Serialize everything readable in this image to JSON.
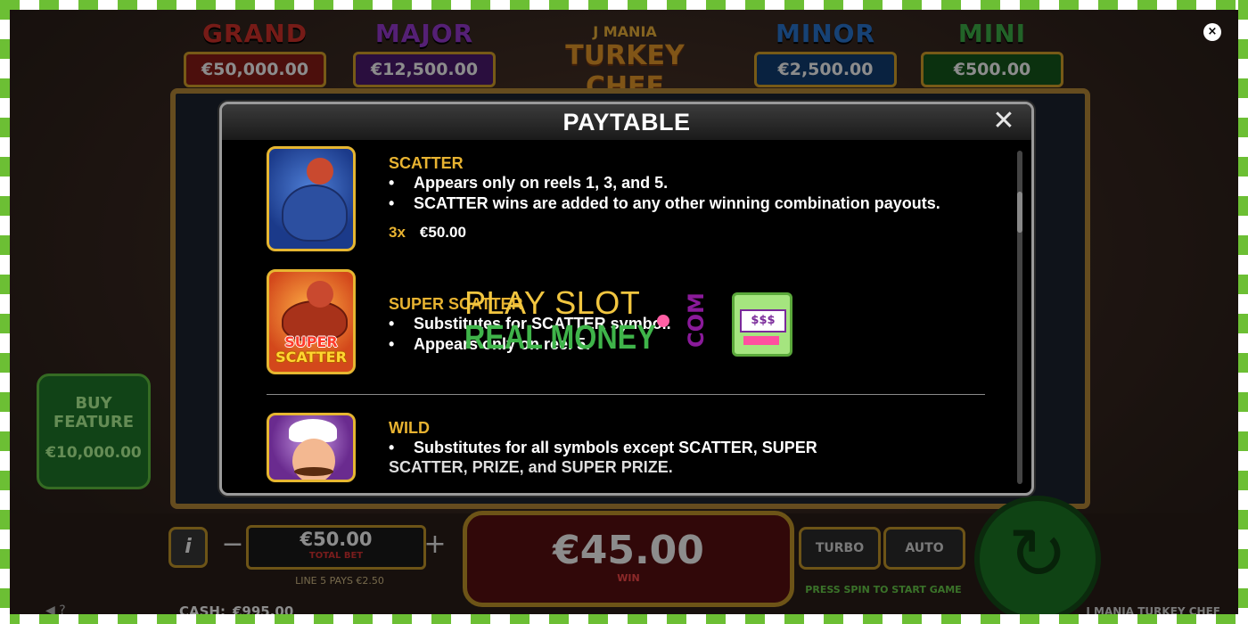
{
  "game": {
    "name": "J MANIA TURKEY CHEF",
    "logo_line1": "J MANIA",
    "logo_line2": "TURKEY CHEF"
  },
  "jackpots": [
    {
      "title": "GRAND",
      "value": "€50,000.00",
      "color": "#d8322a"
    },
    {
      "title": "MAJOR",
      "value": "€12,500.00",
      "color": "#9b3bd6"
    },
    {
      "title": "MINOR",
      "value": "€2,500.00",
      "color": "#2a79d6"
    },
    {
      "title": "MINI",
      "value": "€500.00",
      "color": "#3fb44a"
    }
  ],
  "buy_feature": {
    "label_line1": "BUY",
    "label_line2": "FEATURE",
    "price": "€10,000.00"
  },
  "controls": {
    "info": "i",
    "minus": "−",
    "plus": "+",
    "total_bet_value": "€50.00",
    "total_bet_label": "TOTAL BET",
    "lines_text": "LINE 5 PAYS €2.50",
    "win_value": "€45.00",
    "win_label": "WIN",
    "turbo": "TURBO",
    "auto": "AUTO",
    "press_hint": "PRESS SPIN TO START GAME",
    "spin_icon": "↻",
    "cash_label": "CASH:",
    "cash_value": "€995.00",
    "bottom_icons": "◀ ?"
  },
  "overlay_close": "×",
  "paytable": {
    "title": "PAYTABLE",
    "close": "✕",
    "symbols": [
      {
        "name": "SCATTER",
        "bullets": [
          "Appears only on reels 1, 3, and 5.",
          "SCATTER wins are added to any other winning combination payouts."
        ],
        "pay_multiplier": "3x",
        "pay_value": "€50.00"
      },
      {
        "name": "SUPER SCATTER",
        "icon_text_1": "SUPER",
        "icon_text_2": "SCATTER",
        "bullets": [
          "Substitutes for SCATTER symbol.",
          "Appears only on reel 5."
        ]
      },
      {
        "name": "WILD",
        "bullet": "Substitutes for all symbols except SCATTER, SUPER",
        "bullet_continued": "SCATTER, PRIZE, and SUPER PRIZE."
      }
    ]
  },
  "watermark": {
    "line1": "PLAY SLOT",
    "line2": "REAL MONEY",
    "com": "COM",
    "machine_symbols": "$$$"
  }
}
